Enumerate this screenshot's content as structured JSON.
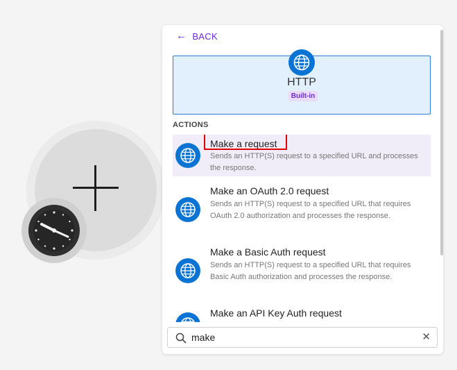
{
  "panel": {
    "back_label": "BACK",
    "app": {
      "name": "HTTP",
      "badge": "Built-in",
      "icon": "globe-icon"
    },
    "section_label": "ACTIONS",
    "actions": [
      {
        "title": "Make a request",
        "description": "Sends an HTTP(S) request to a specified URL and processes the response."
      },
      {
        "title": "Make an OAuth 2.0 request",
        "description": "Sends an HTTP(S) request to a specified URL that requires OAuth 2.0 authorization and processes the response."
      },
      {
        "title": "Make a Basic Auth request",
        "description": "Sends an HTTP(S) request to a specified URL that requires Basic Auth authorization and processes the response."
      },
      {
        "title": "Make an API Key Auth request",
        "description": ""
      }
    ],
    "search": {
      "value": "make",
      "clear_symbol": "✕"
    }
  },
  "canvas": {
    "module_icon": "plus-icon",
    "schedule_icon": "clock-icon"
  },
  "colors": {
    "accent": "#6d28d9",
    "http_blue": "#0a74d5",
    "highlight": "#e00000"
  }
}
